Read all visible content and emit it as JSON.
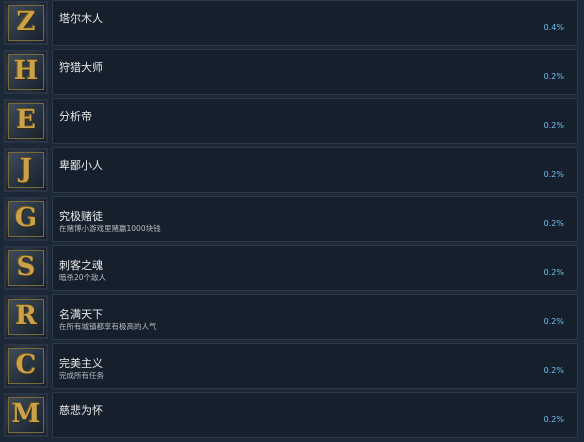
{
  "achievements": [
    {
      "title": "塔尔木人",
      "description": "",
      "percent": "0.4%",
      "icon": "Z",
      "icon_name": "letter-z-badge-icon"
    },
    {
      "title": "狩猎大师",
      "description": "",
      "percent": "0.2%",
      "icon": "H",
      "icon_name": "letter-h-badge-icon"
    },
    {
      "title": "分析帝",
      "description": "",
      "percent": "0.2%",
      "icon": "E",
      "icon_name": "letter-e-badge-icon"
    },
    {
      "title": "卑鄙小人",
      "description": "",
      "percent": "0.2%",
      "icon": "J",
      "icon_name": "letter-j-badge-icon"
    },
    {
      "title": "究极赌徒",
      "description": "在赌博小游戏里赌赢1000块钱",
      "percent": "0.2%",
      "icon": "G",
      "icon_name": "letter-g-badge-icon"
    },
    {
      "title": "刺客之魂",
      "description": "暗杀20个敌人",
      "percent": "0.2%",
      "icon": "S",
      "icon_name": "letter-s-badge-icon"
    },
    {
      "title": "名满天下",
      "description": "在所有城镇都享有极高的人气",
      "percent": "0.2%",
      "icon": "R",
      "icon_name": "letter-r-badge-icon"
    },
    {
      "title": "完美主义",
      "description": "完成所有任务",
      "percent": "0.2%",
      "icon": "C",
      "icon_name": "letter-c-badge-icon"
    },
    {
      "title": "慈悲为怀",
      "description": "",
      "percent": "0.2%",
      "icon": "M",
      "icon_name": "letter-m-badge-icon"
    }
  ],
  "colors": {
    "background": "#1b2838",
    "panel": "#16202d",
    "percent": "#6ec0f0",
    "title": "#e8e8e8",
    "icon_gold": "#c9a24a"
  }
}
